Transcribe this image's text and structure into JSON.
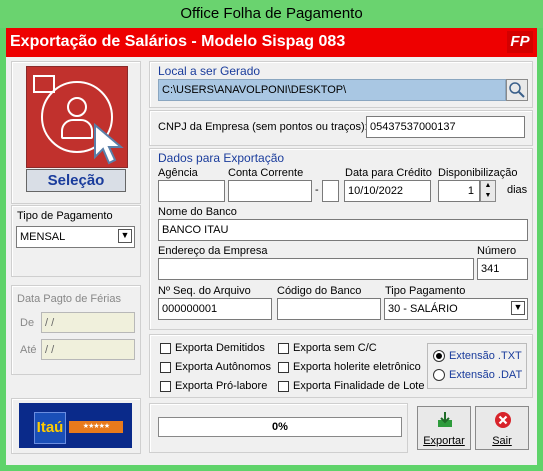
{
  "window": {
    "title": "Office Folha de Pagamento"
  },
  "header": {
    "title": "Exportação de Salários - Modelo Sispag 083",
    "badge": "FP"
  },
  "left": {
    "selecao_label": "Seleção",
    "tipo_pagamento_label": "Tipo de Pagamento",
    "tipo_pagamento_value": "MENSAL",
    "ferias_label": "Data Pagto de Férias",
    "de_label": "De",
    "de_value": "/  /",
    "ate_label": "Até",
    "ate_value": "/  /",
    "bank_logo_text": "Itaú",
    "bank_logo_stars": "★★★★★"
  },
  "local": {
    "label": "Local a ser Gerado",
    "path": "C:\\USERS\\ANAVOLPONI\\DESKTOP\\"
  },
  "cnpj": {
    "label": "CNPJ da Empresa (sem pontos ou traços):",
    "value": "05437537000137"
  },
  "dados": {
    "section_label": "Dados para Exportação",
    "agencia_label": "Agência",
    "agencia_value": "",
    "conta_label": "Conta Corrente",
    "conta_value": "",
    "dash": "-",
    "digito_value": "",
    "data_credito_label": "Data para Crédito",
    "data_credito_value": "10/10/2022",
    "disp_label": "Disponibilização",
    "disp_value": "1",
    "dias_label": "dias",
    "banco_label": "Nome do Banco",
    "banco_value": "BANCO ITAU",
    "endereco_label": "Endereço da Empresa",
    "endereco_value": "",
    "numero_label": "Número",
    "numero_value": "341",
    "seq_label": "Nº Seq. do Arquivo",
    "seq_value": "000000001",
    "codigo_label": "Código do Banco",
    "codigo_value": "",
    "tipo_label": "Tipo Pagamento",
    "tipo_value": "30 - SALÁRIO"
  },
  "options": {
    "demitidos": "Exporta Demitidos",
    "autonomos": "Exporta Autônomos",
    "prolabore": "Exporta Pró-labore",
    "sem_cc": "Exporta sem C/C",
    "holerite": "Exporta holerite eletrônico",
    "finalidade": "Exporta Finalidade de Lote",
    "ext_txt": "Extensão .TXT",
    "ext_dat": "Extensão .DAT"
  },
  "progress": {
    "text": "0%",
    "value": 0
  },
  "buttons": {
    "exportar": "Exportar",
    "sair": "Sair"
  },
  "colors": {
    "header": "#ee0000",
    "title_bar": "#6ad36f",
    "label_blue": "#1a3c9c"
  }
}
